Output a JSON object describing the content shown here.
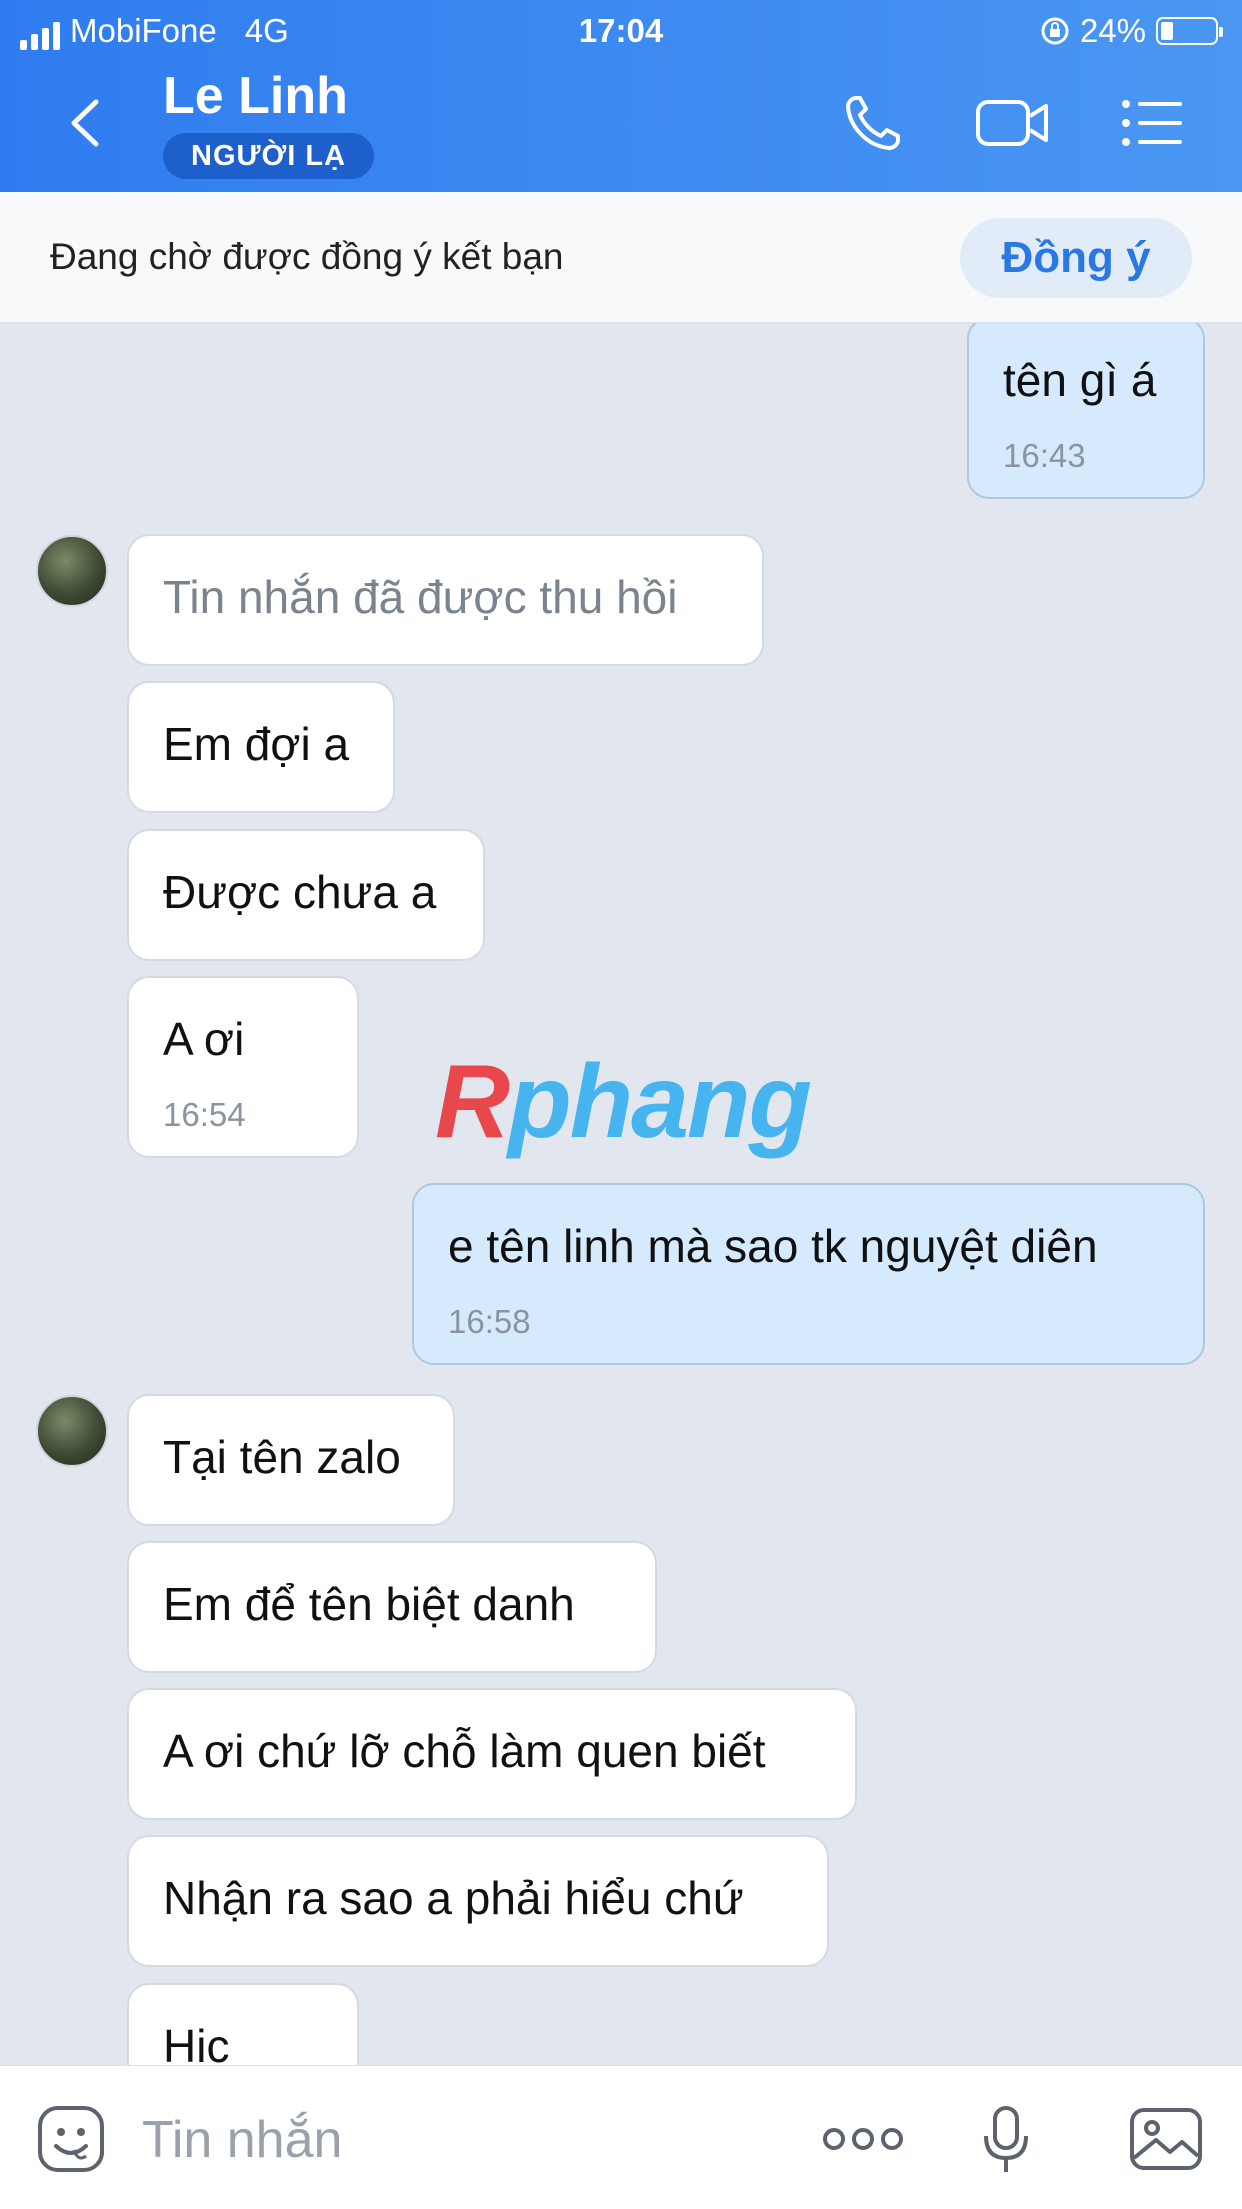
{
  "status_bar": {
    "carrier": "MobiFone",
    "network": "4G",
    "time": "17:04",
    "battery": "24%",
    "battery_level": 0.24
  },
  "header": {
    "title": "Le Linh",
    "badge": "NGƯỜI LẠ",
    "icons": [
      "back-chevron-icon",
      "phone-icon",
      "video-call-icon",
      "menu-list-icon"
    ]
  },
  "friend_request": {
    "text": "Đang chờ được đồng ý kết bạn",
    "accept_label": "Đồng ý"
  },
  "messages": [
    {
      "dir": "out",
      "text": "tên gì á",
      "time": "16:43"
    },
    {
      "dir": "in",
      "text": "Tin nhắn đã được thu hồi",
      "recalled": true
    },
    {
      "dir": "in",
      "text": "Em đợi a"
    },
    {
      "dir": "in",
      "text": "Được chưa a"
    },
    {
      "dir": "in",
      "text": "A ơi",
      "time": "16:54"
    },
    {
      "dir": "out",
      "text": "e tên linh mà sao tk nguyệt diên",
      "time": "16:58"
    },
    {
      "dir": "in",
      "text": "Tại tên zalo"
    },
    {
      "dir": "in",
      "text": "Em để tên biệt danh"
    },
    {
      "dir": "in",
      "text": "A ơi chứ lỡ chỗ làm quen biết"
    },
    {
      "dir": "in",
      "text": "Nhận ra sao a phải hiểu chứ"
    },
    {
      "dir": "in",
      "text": "Hic"
    }
  ],
  "watermark": {
    "text_first": "R",
    "text_rest": "phang"
  },
  "input": {
    "placeholder": "Tin nhắn",
    "icons": [
      "sticker-icon",
      "more-dots-icon",
      "microphone-icon",
      "image-icon"
    ]
  }
}
